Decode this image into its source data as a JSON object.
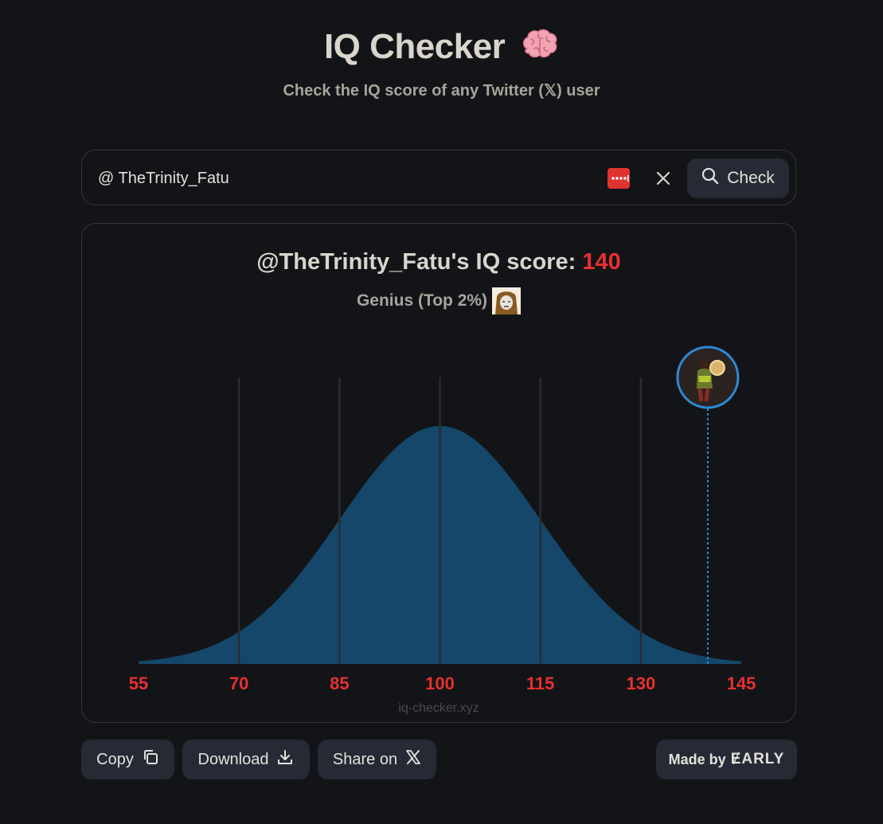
{
  "header": {
    "title": "IQ Checker",
    "subtitle": "Check the IQ score of any Twitter (𝕏) user",
    "icon": "brain-icon"
  },
  "search": {
    "value": "@ TheTrinity_Fatu",
    "check_label": "Check"
  },
  "result": {
    "score_prefix": "@TheTrinity_Fatu's IQ score: ",
    "score": "140",
    "category": "Genius (Top 2%)"
  },
  "chart_data": {
    "type": "area",
    "distribution": "normal",
    "mean": 100,
    "std": 15,
    "x_ticks": [
      "55",
      "70",
      "85",
      "100",
      "115",
      "130",
      "145"
    ],
    "xlim": [
      55,
      145
    ],
    "marker_x": 140,
    "fill_color": "#14476a",
    "marker_color": "#2e8ad6",
    "tick_color": "#e5312f"
  },
  "watermark": "iq-checker.xyz",
  "actions": {
    "copy_label": "Copy",
    "download_label": "Download",
    "share_label": "Share on"
  },
  "footer": {
    "made_by_label": "Made by",
    "brand": "ɆARLY"
  },
  "colors": {
    "background": "#131417",
    "accent": "#e5312f",
    "button": "#262a35"
  }
}
